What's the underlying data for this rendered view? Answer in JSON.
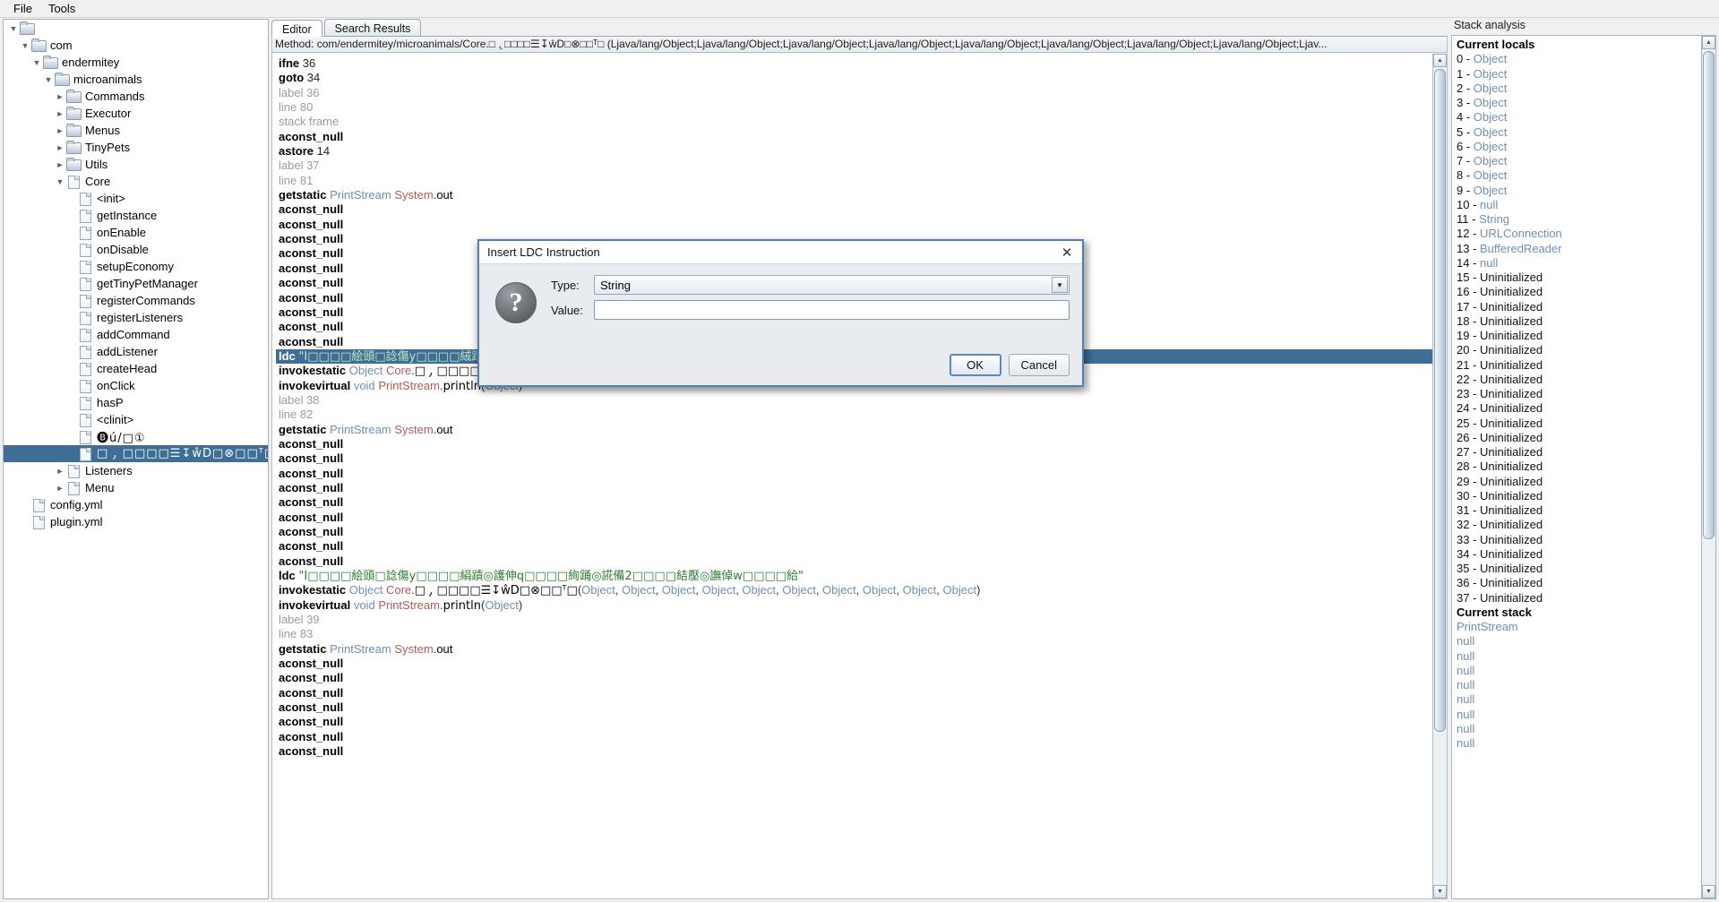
{
  "menubar": {
    "items": [
      {
        "label": "File"
      },
      {
        "label": "Tools"
      }
    ]
  },
  "tree": {
    "nodes": [
      {
        "label": "",
        "depth": 0,
        "twisty": "▼",
        "icon": "folder"
      },
      {
        "label": "com",
        "depth": 1,
        "twisty": "▼",
        "icon": "folder"
      },
      {
        "label": "endermitey",
        "depth": 2,
        "twisty": "▼",
        "icon": "folder"
      },
      {
        "label": "microanimals",
        "depth": 3,
        "twisty": "▼",
        "icon": "folder"
      },
      {
        "label": "Commands",
        "depth": 4,
        "twisty": "►",
        "icon": "folder"
      },
      {
        "label": "Executor",
        "depth": 4,
        "twisty": "►",
        "icon": "folder"
      },
      {
        "label": "Menus",
        "depth": 4,
        "twisty": "►",
        "icon": "folder"
      },
      {
        "label": "TinyPets",
        "depth": 4,
        "twisty": "►",
        "icon": "folder"
      },
      {
        "label": "Utils",
        "depth": 4,
        "twisty": "►",
        "icon": "folder"
      },
      {
        "label": "Core",
        "depth": 4,
        "twisty": "▼",
        "icon": "file"
      },
      {
        "label": "<init>",
        "depth": 5,
        "twisty": "",
        "icon": "file"
      },
      {
        "label": "getInstance",
        "depth": 5,
        "twisty": "",
        "icon": "file"
      },
      {
        "label": "onEnable",
        "depth": 5,
        "twisty": "",
        "icon": "file"
      },
      {
        "label": "onDisable",
        "depth": 5,
        "twisty": "",
        "icon": "file"
      },
      {
        "label": "setupEconomy",
        "depth": 5,
        "twisty": "",
        "icon": "file"
      },
      {
        "label": "getTinyPetManager",
        "depth": 5,
        "twisty": "",
        "icon": "file"
      },
      {
        "label": "registerCommands",
        "depth": 5,
        "twisty": "",
        "icon": "file"
      },
      {
        "label": "registerListeners",
        "depth": 5,
        "twisty": "",
        "icon": "file"
      },
      {
        "label": "addCommand",
        "depth": 5,
        "twisty": "",
        "icon": "file"
      },
      {
        "label": "addListener",
        "depth": 5,
        "twisty": "",
        "icon": "file"
      },
      {
        "label": "createHead",
        "depth": 5,
        "twisty": "",
        "icon": "file"
      },
      {
        "label": "onClick",
        "depth": 5,
        "twisty": "",
        "icon": "file"
      },
      {
        "label": "hasP",
        "depth": 5,
        "twisty": "",
        "icon": "file"
      },
      {
        "label": "<clinit>",
        "depth": 5,
        "twisty": "",
        "icon": "file"
      },
      {
        "label": "🅑ú/□①",
        "depth": 5,
        "twisty": "",
        "icon": "file",
        "mojibake": true
      },
      {
        "label": "□ ,̦  □□□□☰↧ŵD□⊗□□ᵀ□",
        "depth": 5,
        "twisty": "",
        "icon": "file",
        "mojibake": true,
        "selected": true
      },
      {
        "label": "Listeners",
        "depth": 4,
        "twisty": "►",
        "icon": "file"
      },
      {
        "label": "Menu",
        "depth": 4,
        "twisty": "►",
        "icon": "file"
      },
      {
        "label": "config.yml",
        "depth": 1,
        "twisty": "",
        "icon": "file"
      },
      {
        "label": "plugin.yml",
        "depth": 1,
        "twisty": "",
        "icon": "file"
      }
    ]
  },
  "editor": {
    "tabs": [
      {
        "label": "Editor",
        "active": true
      },
      {
        "label": "Search Results",
        "active": false
      }
    ],
    "method_bar": "Method: com/endermitey/microanimals/Core.□ ,̦  □□□□☰↧ŵD□⊗□□ᵀ□ (Ljava/lang/Object;Ljava/lang/Object;Ljava/lang/Object;Ljava/lang/Object;Ljava/lang/Object;Ljava/lang/Object;Ljava/lang/Object;Ljava/lang/Object;Ljav...",
    "lines": [
      {
        "kind": "instr",
        "op": "ifne",
        "arg": "36"
      },
      {
        "kind": "instr",
        "op": "goto",
        "arg": "34"
      },
      {
        "kind": "dim",
        "text": "label 36"
      },
      {
        "kind": "dim",
        "text": "line 80"
      },
      {
        "kind": "dim",
        "text": "stack frame"
      },
      {
        "kind": "instr",
        "op": "aconst_null",
        "arg": ""
      },
      {
        "kind": "instr",
        "op": "astore",
        "arg": "14"
      },
      {
        "kind": "dim",
        "text": "label 37"
      },
      {
        "kind": "dim",
        "text": "line 81"
      },
      {
        "kind": "getstatic",
        "op": "getstatic",
        "type": "PrintStream",
        "owner": "System",
        "member": "out"
      },
      {
        "kind": "instr",
        "op": "aconst_null",
        "arg": ""
      },
      {
        "kind": "instr",
        "op": "aconst_null",
        "arg": ""
      },
      {
        "kind": "instr",
        "op": "aconst_null",
        "arg": ""
      },
      {
        "kind": "instr",
        "op": "aconst_null",
        "arg": ""
      },
      {
        "kind": "instr",
        "op": "aconst_null",
        "arg": ""
      },
      {
        "kind": "instr",
        "op": "aconst_null",
        "arg": ""
      },
      {
        "kind": "instr",
        "op": "aconst_null",
        "arg": ""
      },
      {
        "kind": "instr",
        "op": "aconst_null",
        "arg": ""
      },
      {
        "kind": "instr",
        "op": "aconst_null",
        "arg": ""
      },
      {
        "kind": "instr",
        "op": "aconst_null",
        "arg": ""
      },
      {
        "kind": "ldc",
        "op": "ldc",
        "value": "\"I□□□□絵頭□諗傷y□□□□絨踖◎護傔{□□□□埶壐□詔備w□□□□縱閸⒮諁備v□□□□�ist跿⒱誳略{□□□\"",
        "selected": true
      },
      {
        "kind": "invokestatic",
        "op": "invokestatic",
        "ret": "Object",
        "owner": "Core",
        "member": "□ ,̦  □□□□☰↧ŵD□⊗□□ᵀ□",
        "args": [
          "Object",
          "Object",
          "Object",
          "Object",
          "Object",
          "Object",
          "Object",
          "Object",
          "Object",
          "Object"
        ]
      },
      {
        "kind": "invokevirtual",
        "op": "invokevirtual",
        "ret": "void",
        "owner": "PrintStream",
        "member": "println",
        "args": [
          "Object"
        ]
      },
      {
        "kind": "dim",
        "text": "label 38"
      },
      {
        "kind": "dim",
        "text": "line 82"
      },
      {
        "kind": "getstatic",
        "op": "getstatic",
        "type": "PrintStream",
        "owner": "System",
        "member": "out"
      },
      {
        "kind": "instr",
        "op": "aconst_null",
        "arg": ""
      },
      {
        "kind": "instr",
        "op": "aconst_null",
        "arg": ""
      },
      {
        "kind": "instr",
        "op": "aconst_null",
        "arg": ""
      },
      {
        "kind": "instr",
        "op": "aconst_null",
        "arg": ""
      },
      {
        "kind": "instr",
        "op": "aconst_null",
        "arg": ""
      },
      {
        "kind": "instr",
        "op": "aconst_null",
        "arg": ""
      },
      {
        "kind": "instr",
        "op": "aconst_null",
        "arg": ""
      },
      {
        "kind": "instr",
        "op": "aconst_null",
        "arg": ""
      },
      {
        "kind": "instr",
        "op": "aconst_null",
        "arg": ""
      },
      {
        "kind": "ldc",
        "op": "ldc",
        "value": "\"I□□□□絵頭□諗傷y□□□□絹蹟◎護伸q□□□□絢踊◎誮備2□□□□結壓◎譕倬w□□□□給\""
      },
      {
        "kind": "invokestatic",
        "op": "invokestatic",
        "ret": "Object",
        "owner": "Core",
        "member": "□ ,̦  □□□□☰↧ŵD□⊗□□ᵀ□",
        "args": [
          "Object",
          "Object",
          "Object",
          "Object",
          "Object",
          "Object",
          "Object",
          "Object",
          "Object",
          "Object"
        ]
      },
      {
        "kind": "invokevirtual",
        "op": "invokevirtual",
        "ret": "void",
        "owner": "PrintStream",
        "member": "println",
        "args": [
          "Object"
        ]
      },
      {
        "kind": "dim",
        "text": "label 39"
      },
      {
        "kind": "dim",
        "text": "line 83"
      },
      {
        "kind": "getstatic",
        "op": "getstatic",
        "type": "PrintStream",
        "owner": "System",
        "member": "out"
      },
      {
        "kind": "instr",
        "op": "aconst_null",
        "arg": ""
      },
      {
        "kind": "instr",
        "op": "aconst_null",
        "arg": ""
      },
      {
        "kind": "instr",
        "op": "aconst_null",
        "arg": ""
      },
      {
        "kind": "instr",
        "op": "aconst_null",
        "arg": ""
      },
      {
        "kind": "instr",
        "op": "aconst_null",
        "arg": ""
      },
      {
        "kind": "instr",
        "op": "aconst_null",
        "arg": ""
      },
      {
        "kind": "instr",
        "op": "aconst_null",
        "arg": ""
      }
    ]
  },
  "stack_analysis": {
    "title": "Stack analysis",
    "locals_header": "Current locals",
    "locals": [
      {
        "idx": "0 - ",
        "val": "Object"
      },
      {
        "idx": "1 - ",
        "val": "Object"
      },
      {
        "idx": "2 - ",
        "val": "Object"
      },
      {
        "idx": "3 - ",
        "val": "Object"
      },
      {
        "idx": "4 - ",
        "val": "Object"
      },
      {
        "idx": "5 - ",
        "val": "Object"
      },
      {
        "idx": "6 - ",
        "val": "Object"
      },
      {
        "idx": "7 - ",
        "val": "Object"
      },
      {
        "idx": "8 - ",
        "val": "Object"
      },
      {
        "idx": "9 - ",
        "val": "Object"
      },
      {
        "idx": "10 - ",
        "val": "null"
      },
      {
        "idx": "11 - ",
        "val": "String"
      },
      {
        "idx": "12 - ",
        "val": "URLConnection"
      },
      {
        "idx": "13 - ",
        "val": "BufferedReader"
      },
      {
        "idx": "14 - ",
        "val": "null"
      },
      {
        "idx": "15 - ",
        "val": "Uninitialized",
        "uninit": true
      },
      {
        "idx": "16 - ",
        "val": "Uninitialized",
        "uninit": true
      },
      {
        "idx": "17 - ",
        "val": "Uninitialized",
        "uninit": true
      },
      {
        "idx": "18 - ",
        "val": "Uninitialized",
        "uninit": true
      },
      {
        "idx": "19 - ",
        "val": "Uninitialized",
        "uninit": true
      },
      {
        "idx": "20 - ",
        "val": "Uninitialized",
        "uninit": true
      },
      {
        "idx": "21 - ",
        "val": "Uninitialized",
        "uninit": true
      },
      {
        "idx": "22 - ",
        "val": "Uninitialized",
        "uninit": true
      },
      {
        "idx": "23 - ",
        "val": "Uninitialized",
        "uninit": true
      },
      {
        "idx": "24 - ",
        "val": "Uninitialized",
        "uninit": true
      },
      {
        "idx": "25 - ",
        "val": "Uninitialized",
        "uninit": true
      },
      {
        "idx": "26 - ",
        "val": "Uninitialized",
        "uninit": true
      },
      {
        "idx": "27 - ",
        "val": "Uninitialized",
        "uninit": true
      },
      {
        "idx": "28 - ",
        "val": "Uninitialized",
        "uninit": true
      },
      {
        "idx": "29 - ",
        "val": "Uninitialized",
        "uninit": true
      },
      {
        "idx": "30 - ",
        "val": "Uninitialized",
        "uninit": true
      },
      {
        "idx": "31 - ",
        "val": "Uninitialized",
        "uninit": true
      },
      {
        "idx": "32 - ",
        "val": "Uninitialized",
        "uninit": true
      },
      {
        "idx": "33 - ",
        "val": "Uninitialized",
        "uninit": true
      },
      {
        "idx": "34 - ",
        "val": "Uninitialized",
        "uninit": true
      },
      {
        "idx": "35 - ",
        "val": "Uninitialized",
        "uninit": true
      },
      {
        "idx": "36 - ",
        "val": "Uninitialized",
        "uninit": true
      },
      {
        "idx": "37 - ",
        "val": "Uninitialized",
        "uninit": true
      }
    ],
    "stack_header": "Current stack",
    "stack": [
      {
        "val": "PrintStream"
      },
      {
        "val": "null"
      },
      {
        "val": "null"
      },
      {
        "val": "null"
      },
      {
        "val": "null"
      },
      {
        "val": "null"
      },
      {
        "val": "null"
      },
      {
        "val": "null"
      },
      {
        "val": "null"
      }
    ]
  },
  "dialog": {
    "title": "Insert LDC Instruction",
    "close_icon": "✕",
    "question_icon": "?",
    "type_label": "Type:",
    "type_value": "String",
    "type_arrow": "▼",
    "value_label": "Value:",
    "value_text": "",
    "value_placeholder": "",
    "ok_label": "OK",
    "cancel_label": "Cancel"
  },
  "colors": {
    "selection": "#3e6e96",
    "dialog_border": "#4f80b5",
    "type_link": "#6e8fb5",
    "class_name": "#b05a5a",
    "string_literal": "#2e7d32"
  }
}
